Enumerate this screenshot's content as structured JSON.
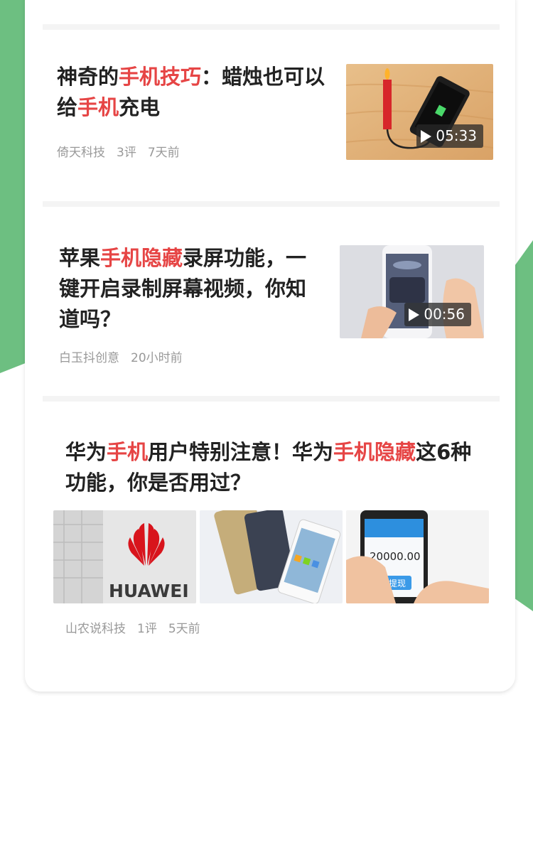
{
  "articles": [
    {
      "title_parts": [
        {
          "text": "神奇的",
          "hl": false
        },
        {
          "text": "手机技巧",
          "hl": true
        },
        {
          "text": "：蜡烛也可以给",
          "hl": false
        },
        {
          "text": "手机",
          "hl": true
        },
        {
          "text": "充电",
          "hl": false
        }
      ],
      "source": "倚天科技",
      "comments": "3评",
      "time": "7天前",
      "duration": "05:33"
    },
    {
      "title_parts": [
        {
          "text": "苹果",
          "hl": false
        },
        {
          "text": "手机隐藏",
          "hl": true
        },
        {
          "text": "录屏功能，一键开启录制屏幕视频，你知道吗？",
          "hl": false
        }
      ],
      "source": "白玉抖创意",
      "time": "20小时前",
      "duration": "00:56"
    },
    {
      "title_parts": [
        {
          "text": "华为",
          "hl": false
        },
        {
          "text": "手机",
          "hl": true
        },
        {
          "text": "用户特别注意！华为",
          "hl": false
        },
        {
          "text": "手机隐藏",
          "hl": true
        },
        {
          "text": "这6种功能，你是否用过？",
          "hl": false
        }
      ],
      "source": "山农说科技",
      "comments": "1评",
      "time": "5天前",
      "image_texts": {
        "brand": "HUAWEI",
        "amount": "20000.00",
        "button": "提现"
      }
    }
  ],
  "colors": {
    "highlight": "#e64545",
    "accent_green": "#6dbf81"
  }
}
